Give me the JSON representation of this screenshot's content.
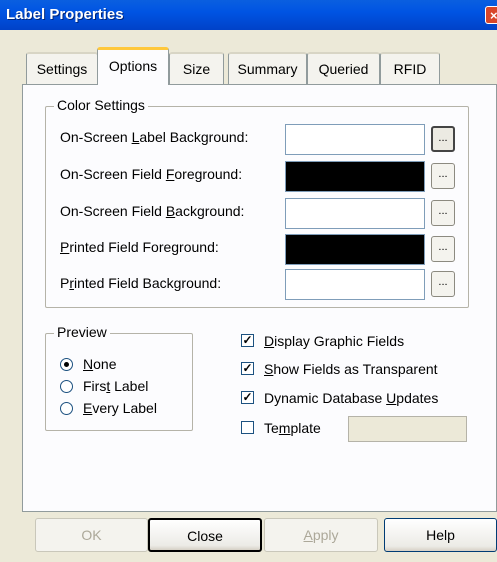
{
  "window": {
    "title": "Label Properties",
    "close_glyph": "×"
  },
  "tabs": [
    {
      "label": "Settings"
    },
    {
      "label": "Options",
      "active": true
    },
    {
      "label": "Size"
    },
    {
      "label": "Summary"
    },
    {
      "label": "Queried"
    },
    {
      "label": "RFID"
    }
  ],
  "color_settings": {
    "title": "Color Settings",
    "rows": [
      {
        "pre": "On-Screen ",
        "acc": "L",
        "post": "abel Background:",
        "swatch": "#ffffff",
        "button": "..."
      },
      {
        "pre": "On-Screen Field ",
        "acc": "F",
        "post": "oreground:",
        "swatch": "#000000",
        "button": "..."
      },
      {
        "pre": "On-Screen Field ",
        "acc": "B",
        "post": "ackground:",
        "swatch": "#ffffff",
        "button": "..."
      },
      {
        "pre": "",
        "acc": "P",
        "post": "rinted Field Foreground:",
        "swatch": "#000000",
        "button": "..."
      },
      {
        "pre": "P",
        "acc": "r",
        "post": "inted Field Background:",
        "swatch": "#ffffff",
        "button": "..."
      }
    ]
  },
  "preview": {
    "title": "Preview",
    "options": [
      {
        "pre": "",
        "acc": "N",
        "post": "one",
        "selected": true
      },
      {
        "pre": "Firs",
        "acc": "t",
        "post": " Label",
        "selected": false
      },
      {
        "pre": "",
        "acc": "E",
        "post": "very Label",
        "selected": false
      }
    ]
  },
  "checkboxes": [
    {
      "pre": "",
      "acc": "D",
      "post": "isplay Graphic Fields",
      "checked": true
    },
    {
      "pre": "",
      "acc": "S",
      "post": "how Fields as Transparent",
      "checked": true
    },
    {
      "pre": "Dynamic Database ",
      "acc": "U",
      "post": "pdates",
      "checked": true
    },
    {
      "pre": "Te",
      "acc": "m",
      "post": "plate",
      "checked": false
    }
  ],
  "template_value": "",
  "buttons": {
    "ok": "OK",
    "close": "Close",
    "apply_acc": "A",
    "apply_post": "pply",
    "help": "Help"
  },
  "colors": {
    "titlebar": "#0054e3",
    "tab_highlight": "#ffc83c",
    "dialog_bg": "#ece9d8"
  }
}
